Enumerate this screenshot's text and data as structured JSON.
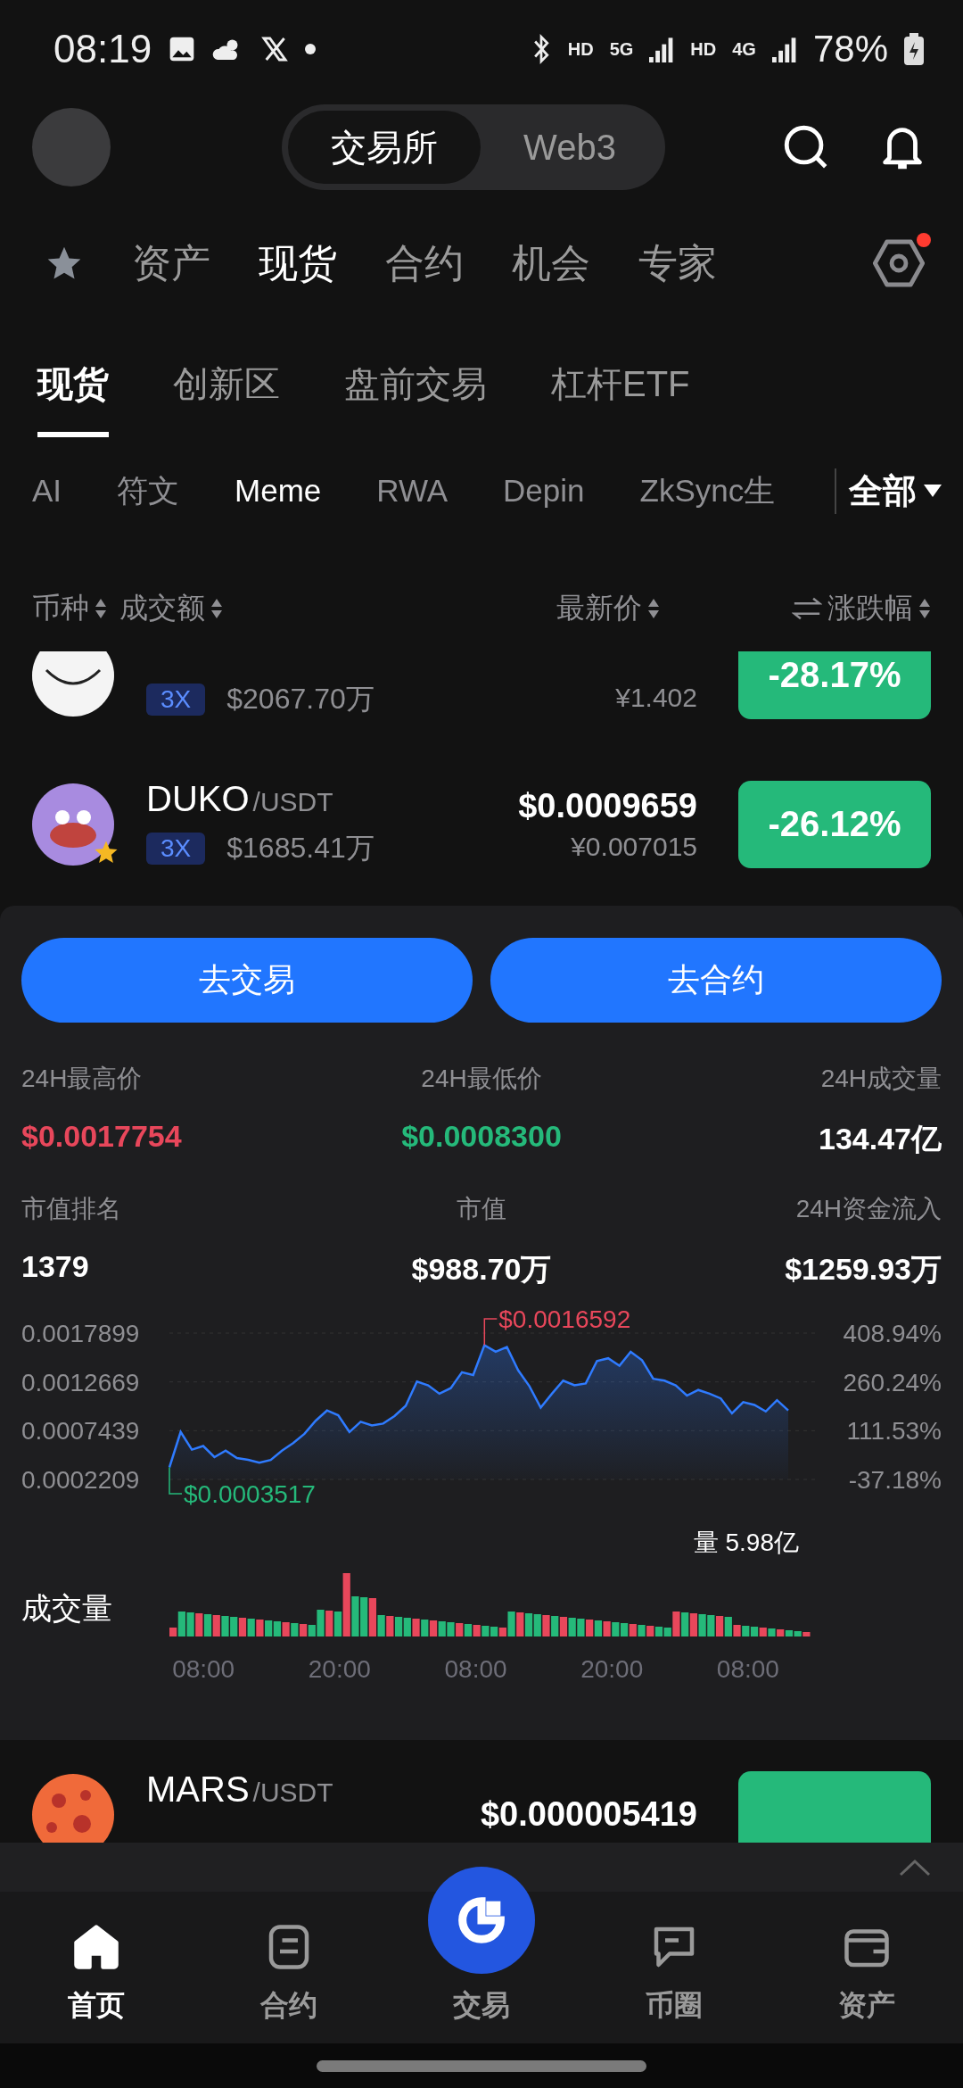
{
  "status_bar": {
    "time": "08:19",
    "network_labels": [
      "HD",
      "5G",
      "HD",
      "4G"
    ],
    "battery": "78%"
  },
  "header": {
    "segments": [
      {
        "label": "交易所",
        "selected": true
      },
      {
        "label": "Web3",
        "selected": false
      }
    ]
  },
  "main_tabs": [
    {
      "label": "资产",
      "selected": false
    },
    {
      "label": "现货",
      "selected": true
    },
    {
      "label": "合约",
      "selected": false
    },
    {
      "label": "机会",
      "selected": false
    },
    {
      "label": "专家",
      "selected": false
    }
  ],
  "settings_alert": true,
  "sub_tabs": [
    {
      "label": "现货",
      "selected": true
    },
    {
      "label": "创新区",
      "selected": false
    },
    {
      "label": "盘前交易",
      "selected": false
    },
    {
      "label": "杠杆ETF",
      "selected": false
    }
  ],
  "categories": [
    {
      "label": "AI",
      "selected": false
    },
    {
      "label": "符文",
      "selected": false
    },
    {
      "label": "Meme",
      "selected": true
    },
    {
      "label": "RWA",
      "selected": false
    },
    {
      "label": "Depin",
      "selected": false
    },
    {
      "label": "ZkSync生",
      "selected": false
    }
  ],
  "category_all": "全部",
  "columns": [
    {
      "label": "币种",
      "kind": "sort"
    },
    {
      "label": "成交额",
      "kind": "sort"
    },
    {
      "label": "最新价",
      "kind": "sort"
    },
    {
      "label": "涨跌幅",
      "kind": "switch"
    }
  ],
  "rows_top": [
    {
      "kind": "plain",
      "starred": false,
      "leverage": "3X",
      "volume": "$2067.70万",
      "price_cny": "¥1.402",
      "change": "-28.17%"
    },
    {
      "kind": "cartoon",
      "starred": true,
      "name": "DUKO",
      "pair": "/USDT",
      "leverage": "3X",
      "volume": "$1685.41万",
      "price": "$0.0009659",
      "price_cny": "¥0.007015",
      "change": "-26.12%"
    }
  ],
  "detail": {
    "buttons": [
      "去交易",
      "去合约"
    ],
    "stats": [
      {
        "label": "24H最高价",
        "value": "$0.0017754",
        "color": "#e8475b"
      },
      {
        "label": "24H最低价",
        "value": "$0.0008300",
        "color": "#25b97a"
      },
      {
        "label": "24H成交量",
        "value": "134.47亿"
      },
      {
        "label": "市值排名",
        "value": "1379"
      },
      {
        "label": "市值",
        "value": "$988.70万"
      },
      {
        "label": "24H资金流入",
        "value": "$1259.93万"
      }
    ],
    "price_chart": {
      "chart_data": {
        "type": "area",
        "ylim": [
          0.0002209,
          0.0017899
        ],
        "yticks": [
          {
            "value": 0.0017899,
            "label": "0.0017899"
          },
          {
            "value": 0.0012669,
            "label": "0.0012669"
          },
          {
            "value": 0.0007439,
            "label": "0.0007439"
          },
          {
            "value": 0.0002209,
            "label": "0.0002209"
          }
        ],
        "series": [
          {
            "color": "#2f7bff",
            "values": [
              0.00035,
              0.00073,
              0.00054,
              0.00058,
              0.00046,
              0.00053,
              0.00045,
              0.00043,
              0.0004,
              0.00043,
              0.00053,
              0.00061,
              0.00071,
              0.00085,
              0.00096,
              0.00091,
              0.00073,
              0.00084,
              0.0008,
              0.00082,
              0.0009,
              0.00101,
              0.00127,
              0.00123,
              0.00114,
              0.0012,
              0.00137,
              0.00134,
              0.00166,
              0.00159,
              0.00164,
              0.00139,
              0.00122,
              0.00099,
              0.00114,
              0.00128,
              0.00123,
              0.00125,
              0.00149,
              0.00152,
              0.00144,
              0.00159,
              0.0015,
              0.0013,
              0.00128,
              0.00123,
              0.00112,
              0.00118,
              0.00114,
              0.00109,
              0.00093,
              0.00105,
              0.00102,
              0.00095,
              0.00107,
              0.00096
            ]
          }
        ],
        "annotations": [
          "$0.0016592",
          "$0.0003517"
        ]
      },
      "right_axis_labels": [
        "408.94%",
        "260.24%",
        "111.53%",
        "-37.18%"
      ]
    },
    "volume_total": "量 5.98亿",
    "volume_label": "成交量",
    "time_labels": [
      "08:00",
      "20:00",
      "08:00",
      "20:00",
      "08:00"
    ]
  },
  "rows_bottom": [
    {
      "kind": "planet",
      "name": "MARS",
      "pair": "/USDT",
      "price": "$0.000005419"
    }
  ],
  "bottom_nav": [
    {
      "label": "首页",
      "selected": true,
      "kind": "home"
    },
    {
      "label": "合约",
      "selected": false,
      "kind": "contract"
    },
    {
      "label": "交易",
      "selected": false,
      "kind": "trade"
    },
    {
      "label": "币圈",
      "selected": false,
      "kind": "chat"
    },
    {
      "label": "资产",
      "selected": false,
      "kind": "wallet"
    }
  ]
}
